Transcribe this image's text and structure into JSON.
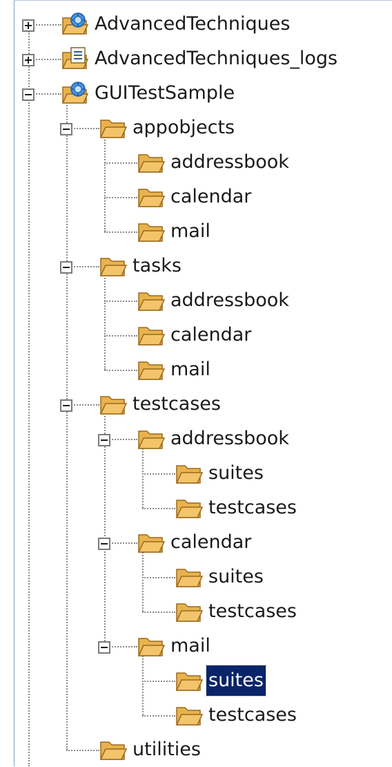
{
  "colors": {
    "selection_bg": "#0a246a",
    "selection_fg": "#ffffff",
    "folder": "#f3c46a",
    "project": "#4a90d9"
  },
  "tree": [
    {
      "label": "AdvancedTechniques",
      "icon": "project-icon",
      "depth": 0,
      "toggle": "plus"
    },
    {
      "label": "AdvancedTechniques_logs",
      "icon": "log-project-icon",
      "depth": 0,
      "toggle": "plus"
    },
    {
      "label": "GUITestSample",
      "icon": "project-icon",
      "depth": 0,
      "toggle": "minus"
    },
    {
      "label": "appobjects",
      "icon": "folder-icon",
      "depth": 1,
      "toggle": "minus"
    },
    {
      "label": "addressbook",
      "icon": "folder-icon",
      "depth": 2
    },
    {
      "label": "calendar",
      "icon": "folder-icon",
      "depth": 2
    },
    {
      "label": "mail",
      "icon": "folder-icon",
      "depth": 2
    },
    {
      "label": "tasks",
      "icon": "folder-icon",
      "depth": 1,
      "toggle": "minus"
    },
    {
      "label": "addressbook",
      "icon": "folder-icon",
      "depth": 2
    },
    {
      "label": "calendar",
      "icon": "folder-icon",
      "depth": 2
    },
    {
      "label": "mail",
      "icon": "folder-icon",
      "depth": 2
    },
    {
      "label": "testcases",
      "icon": "folder-icon",
      "depth": 1,
      "toggle": "minus"
    },
    {
      "label": "addressbook",
      "icon": "folder-icon",
      "depth": 2,
      "toggle": "minus"
    },
    {
      "label": "suites",
      "icon": "folder-icon",
      "depth": 3
    },
    {
      "label": "testcases",
      "icon": "folder-icon",
      "depth": 3
    },
    {
      "label": "calendar",
      "icon": "folder-icon",
      "depth": 2,
      "toggle": "minus"
    },
    {
      "label": "suites",
      "icon": "folder-icon",
      "depth": 3
    },
    {
      "label": "testcases",
      "icon": "folder-icon",
      "depth": 3
    },
    {
      "label": "mail",
      "icon": "folder-icon",
      "depth": 2,
      "toggle": "minus"
    },
    {
      "label": "suites",
      "icon": "folder-icon",
      "depth": 3,
      "selected": true
    },
    {
      "label": "testcases",
      "icon": "folder-icon",
      "depth": 3
    },
    {
      "label": "utilities",
      "icon": "folder-icon",
      "depth": 1
    }
  ]
}
